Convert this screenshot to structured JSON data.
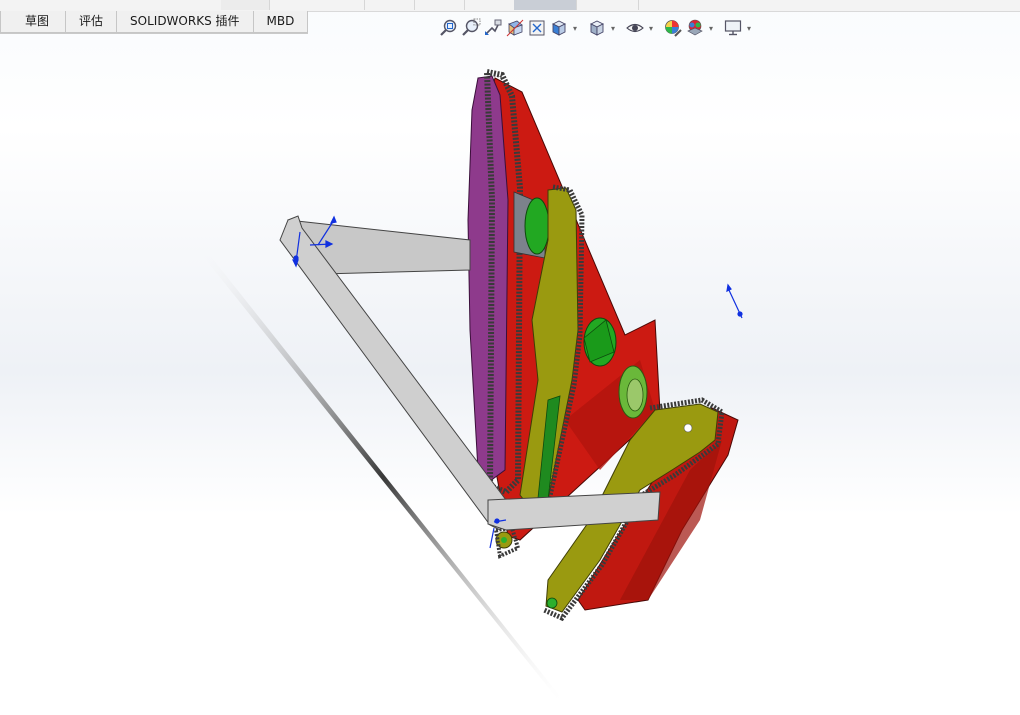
{
  "command_manager": {
    "tabs": [
      {
        "label": "草图"
      },
      {
        "label": "评估"
      },
      {
        "label": "SOLIDWORKS 插件"
      },
      {
        "label": "MBD"
      }
    ]
  },
  "heads_up_toolbar": {
    "tools": [
      {
        "icon": "zoom-to-fit-icon",
        "has_dropdown": false
      },
      {
        "icon": "zoom-to-area-icon",
        "has_dropdown": false
      },
      {
        "icon": "previous-view-icon",
        "has_dropdown": false
      },
      {
        "icon": "section-view-icon",
        "has_dropdown": false
      },
      {
        "icon": "dynamic-annotation-views-icon",
        "has_dropdown": false
      },
      {
        "icon": "view-orientation-icon",
        "has_dropdown": true
      },
      {
        "icon": "display-style-icon",
        "has_dropdown": true
      },
      {
        "icon": "hide-show-items-icon",
        "has_dropdown": true
      },
      {
        "icon": "edit-appearance-icon",
        "has_dropdown": false
      },
      {
        "icon": "apply-scene-icon",
        "has_dropdown": true
      },
      {
        "icon": "view-settings-icon",
        "has_dropdown": true
      }
    ]
  },
  "graphics_area": {
    "model_colors": {
      "frame_red": "#cc1a12",
      "side_plate_purple": "#8e3a8c",
      "arm_olive": "#9a9a10",
      "gear_green": "#22a822",
      "bracket_gray": "#c8c8c8",
      "chain_dark": "#3a3a3a",
      "triad_blue": "#1030e0"
    }
  }
}
